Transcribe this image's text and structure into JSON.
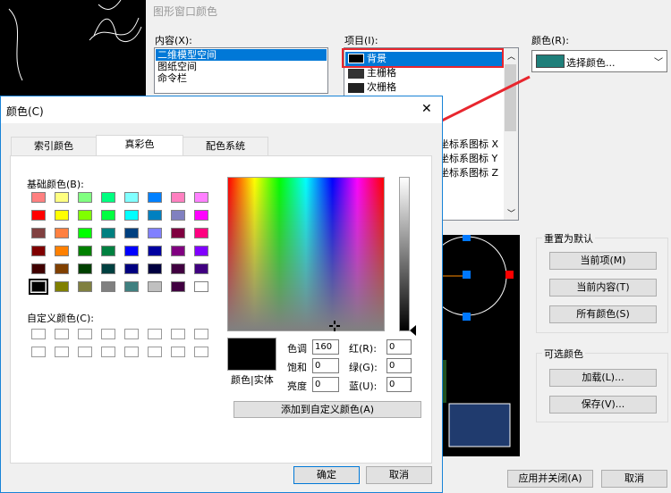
{
  "back_window": {
    "title": "图形窗口颜色",
    "content_label": "内容(X):",
    "content_items": [
      "二维模型空间",
      "图纸空间",
      "命令栏"
    ],
    "item_label": "项目(I):",
    "item_list": [
      "背景",
      "主栅格",
      "次栅格",
      "坐标系图标 X",
      "坐标系图标 Y",
      "坐标系图标 Z"
    ],
    "color_label": "颜色(R):",
    "color_select": "选择颜色...",
    "color_swatch": "#1f7f7a",
    "reset_group_title": "重置为默认",
    "reset_current_item": "当前项(M)",
    "reset_current_content": "当前内容(T)",
    "reset_all_colors": "所有颜色(S)",
    "optional_group_title": "可选颜色",
    "load_button": "加载(L)...",
    "save_button": "保存(V)...",
    "apply_close_button": "应用并关闭(A)",
    "cancel_button": "取消"
  },
  "color_dialog": {
    "title": "颜色(C)",
    "close_glyph": "✕",
    "tabs": [
      "索引颜色",
      "真彩色",
      "配色系统"
    ],
    "active_tab": 1,
    "basic_colors_label": "基础颜色(B):",
    "basic_colors": [
      "#ff8080",
      "#ffff80",
      "#80ff80",
      "#00ff80",
      "#80ffff",
      "#0080ff",
      "#ff80c0",
      "#ff80ff",
      "#ff0000",
      "#ffff00",
      "#80ff00",
      "#00ff40",
      "#00ffff",
      "#0080c0",
      "#8080c0",
      "#ff00ff",
      "#804040",
      "#ff8040",
      "#00ff00",
      "#008080",
      "#004080",
      "#8080ff",
      "#800040",
      "#ff0080",
      "#800000",
      "#ff8000",
      "#008000",
      "#008040",
      "#0000ff",
      "#0000a0",
      "#800080",
      "#8000ff",
      "#400000",
      "#804000",
      "#004000",
      "#004040",
      "#000080",
      "#000040",
      "#400040",
      "#400080",
      "#000000",
      "#808000",
      "#808040",
      "#808080",
      "#408080",
      "#c0c0c0",
      "#400040",
      "#ffffff"
    ],
    "selected_basic_index": 40,
    "custom_colors_label": "自定义颜色(C):",
    "preview_label": "颜色|实体",
    "preview_color": "#000000",
    "hue_label": "色调",
    "hue_value": "160",
    "sat_label": "饱和",
    "sat_value": "0",
    "lum_label": "亮度",
    "lum_value": "0",
    "red_label": "红(R):",
    "red_value": "0",
    "green_label": "绿(G):",
    "green_value": "0",
    "blue_label": "蓝(U):",
    "blue_value": "0",
    "add_custom_button": "添加到自定义颜色(A)",
    "ok_button": "确定",
    "cancel_button": "取消"
  }
}
